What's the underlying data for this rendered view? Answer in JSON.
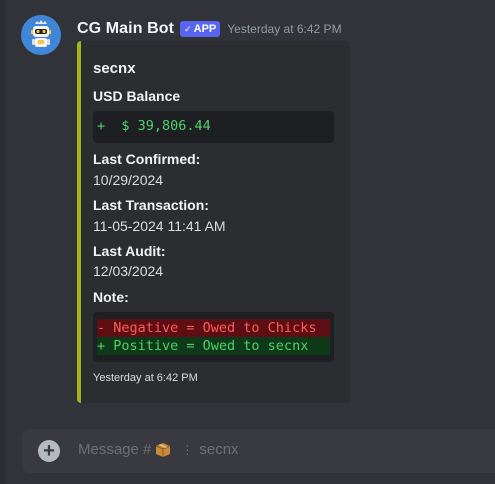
{
  "message": {
    "username": "CG Main Bot",
    "badge": "APP",
    "timestamp": "Yesterday at 6:42 PM"
  },
  "embed": {
    "accent_color": "#a4b41e",
    "title": "secnx",
    "fields": {
      "usd_balance": {
        "name": "USD Balance",
        "value": "+  $ 39,806.44"
      },
      "last_confirmed": {
        "name": "Last Confirmed:",
        "value": "10/29/2024"
      },
      "last_transaction": {
        "name": "Last Transaction:",
        "value": "11-05-2024 11:41 AM"
      },
      "last_audit": {
        "name": "Last Audit:",
        "value": "12/03/2024"
      },
      "note": {
        "name": "Note:",
        "lines": [
          "- Negative = Owed to Chicks",
          "+ Positive = Owed to secnx"
        ]
      }
    },
    "footer": "Yesterday at 6:42 PM"
  },
  "composer": {
    "placeholder_prefix": "Message #",
    "channel_icon": "package-icon",
    "separator": "⋮",
    "channel_name": "secnx"
  }
}
